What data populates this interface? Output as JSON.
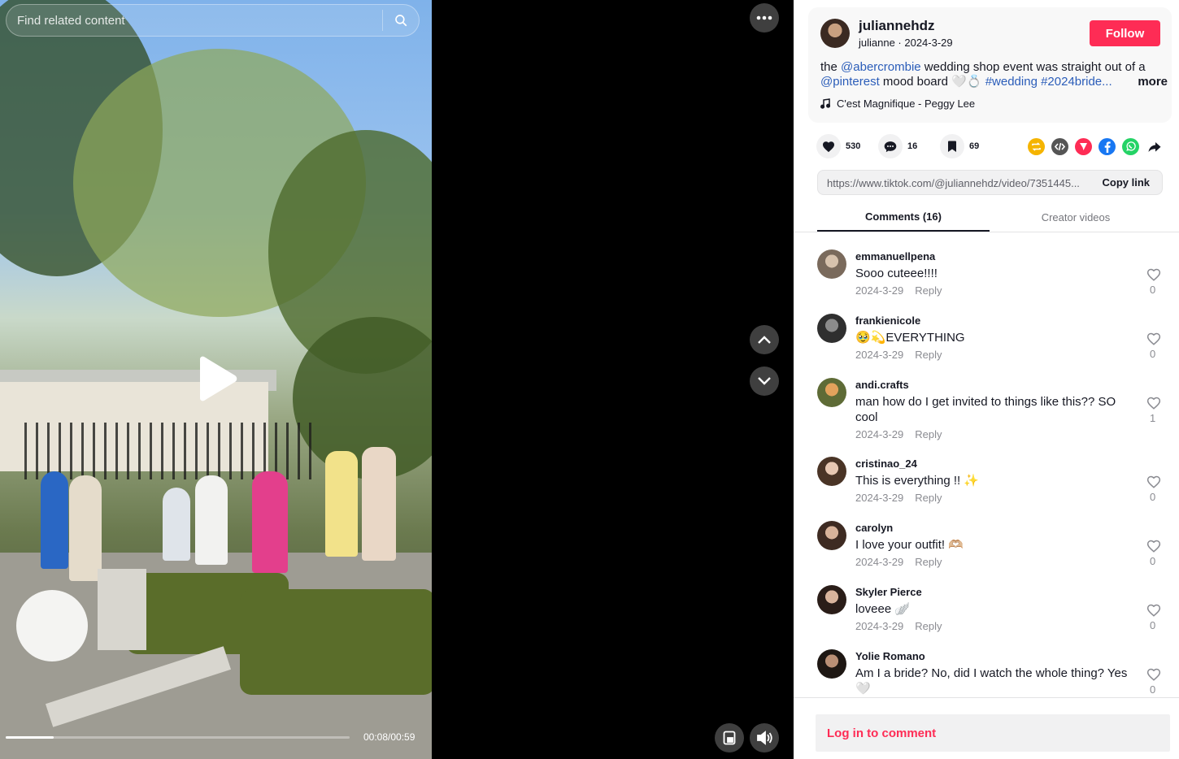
{
  "search": {
    "placeholder": "Find related content"
  },
  "video": {
    "time": "00:08/00:59",
    "progress_fraction": 0.14
  },
  "author": {
    "username": "juliannehdz",
    "nickname_date": "julianne · 2024-3-29",
    "follow_label": "Follow"
  },
  "caption": {
    "prefix": "the ",
    "mention1": "@abercrombie",
    "middle": " wedding shop event was straight out of a ",
    "mention2": "@pinterest",
    "suffix": " mood board 🤍💍 ",
    "hashtags": "#wedding #2024bride...",
    "more_label": "more"
  },
  "music": {
    "title": "C'est Magnifique - Peggy Lee"
  },
  "stats": {
    "likes": "530",
    "comments": "16",
    "saves": "69"
  },
  "share": {
    "link": "https://www.tiktok.com/@juliannehdz/video/7351445...",
    "copy_label": "Copy link"
  },
  "tabs": {
    "comments": "Comments (16)",
    "creator_videos": "Creator videos"
  },
  "comments": [
    {
      "user": "emmanuellpena",
      "text": "Sooo cuteee!!!!",
      "date": "2024-3-29",
      "reply": "Reply",
      "likes": "0"
    },
    {
      "user": "frankienicole",
      "text": "🥹💫EVERYTHING",
      "date": "2024-3-29",
      "reply": "Reply",
      "likes": "0"
    },
    {
      "user": "andi.crafts",
      "text": "man how do I get invited to things like this?? SO cool",
      "date": "2024-3-29",
      "reply": "Reply",
      "likes": "1"
    },
    {
      "user": "cristinao_24",
      "text": "This is everything !! ✨",
      "date": "2024-3-29",
      "reply": "Reply",
      "likes": "0"
    },
    {
      "user": "carolyn",
      "text": "I love your outfit! 🫶🏼",
      "date": "2024-3-29",
      "reply": "Reply",
      "likes": "0"
    },
    {
      "user": "Skyler Pierce",
      "text": "loveee 🪽",
      "date": "2024-3-29",
      "reply": "Reply",
      "likes": "0"
    },
    {
      "user": "Yolie Romano",
      "text": "Am I a bride? No, did I watch the whole thing? Yes 🤍",
      "date": "",
      "reply": "",
      "likes": "0"
    }
  ],
  "footer": {
    "login_label": "Log in to comment"
  },
  "colors": {
    "accent": "#fe2c55",
    "link": "#2b5db9"
  },
  "icons": [
    "search-icon",
    "more-icon",
    "play-icon",
    "chevron-up-icon",
    "chevron-down-icon",
    "miniplayer-icon",
    "volume-icon",
    "heart-icon",
    "comment-icon",
    "bookmark-icon",
    "repost-icon",
    "embed-icon",
    "send-icon",
    "facebook-icon",
    "whatsapp-icon",
    "share-arrow-icon",
    "music-note-icon"
  ]
}
